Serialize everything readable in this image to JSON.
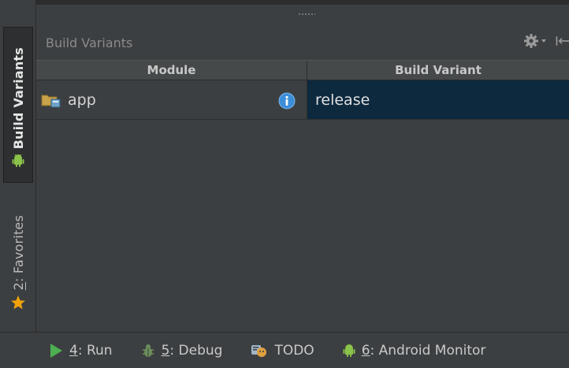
{
  "left_strip": {
    "build_variants_tab": "Build Variants",
    "favorites_tab": {
      "mnemonic": "2",
      "rest": ": Favorites"
    }
  },
  "panel": {
    "title": "Build Variants",
    "columns": {
      "module": "Module",
      "build_variant": "Build Variant"
    },
    "rows": [
      {
        "module": "app",
        "build_variant": "release",
        "selected": true
      }
    ]
  },
  "bottom_bar": {
    "run": {
      "mnemonic": "4",
      "rest": ": Run"
    },
    "debug": {
      "mnemonic": "5",
      "rest": ": Debug"
    },
    "todo": {
      "label": "TODO"
    },
    "android_monitor": {
      "mnemonic": "6",
      "rest": ": Android Monitor"
    }
  },
  "icons": {
    "gear": "gear-icon",
    "dropdown": "chevron-down-icon",
    "hide": "hide-panel-icon",
    "android": "android-icon",
    "star": "star-icon",
    "folder": "module-folder-icon",
    "info": "info-icon",
    "run": "play-icon",
    "debug": "bug-icon",
    "todo": "todo-icon"
  },
  "colors": {
    "background": "#3c3f41",
    "selection": "#0d293e",
    "run_green": "#4caf50",
    "android_green": "#8bc34a",
    "star_orange": "#f0a30a",
    "info_blue": "#3d8ed8"
  }
}
